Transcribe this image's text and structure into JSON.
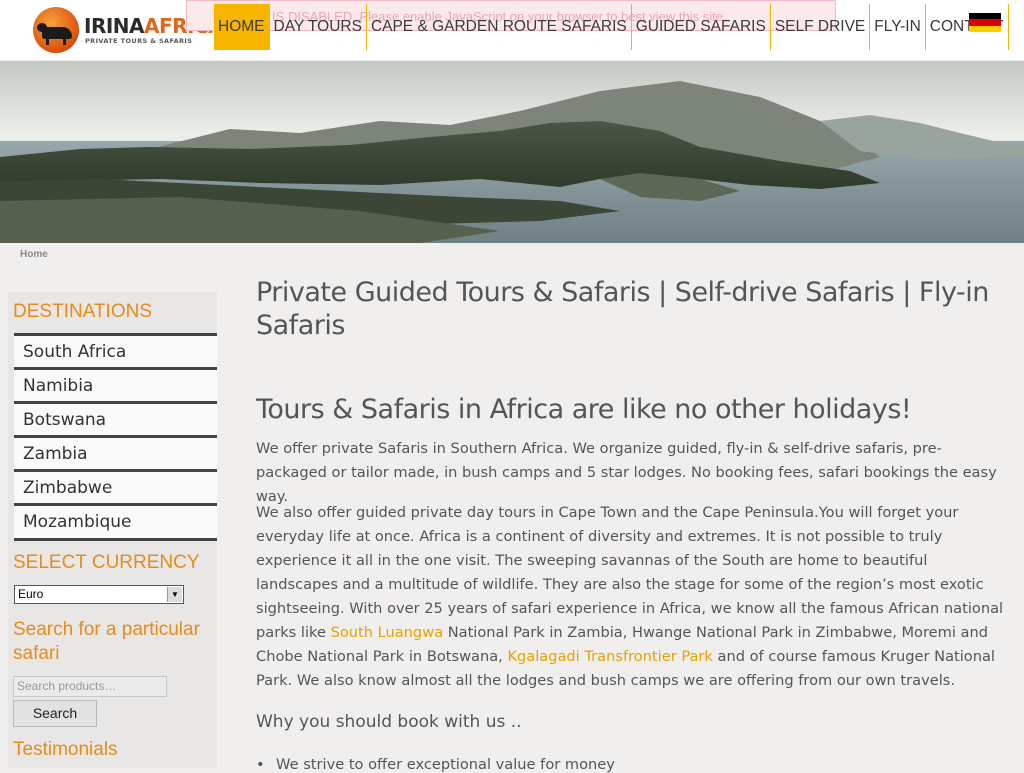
{
  "brand": {
    "name_part1": "IRINA",
    "name_part2": "AFRICA",
    "tagline": "PRIVATE TOURS & SAFARIS"
  },
  "noscript_message": "SCRIPT IS DISABLED. Please enable JavaScript on your browser to best view this site.",
  "nav": [
    {
      "label": "HOME",
      "active": true
    },
    {
      "label": "DAY TOURS"
    },
    {
      "label": "CAPE & GARDEN ROUTE SAFARIS"
    },
    {
      "label": "GUIDED SAFARIS"
    },
    {
      "label": "SELF DRIVE"
    },
    {
      "label": "FLY-IN"
    },
    {
      "label": "CONTACT"
    }
  ],
  "language_flag": {
    "colors": [
      "#000000",
      "#dd0000",
      "#ffce00"
    ]
  },
  "breadcrumb": {
    "home": "Home"
  },
  "sidebar": {
    "destinations_title": "DESTINATIONS",
    "destinations": [
      "South Africa",
      "Namibia",
      "Botswana",
      "Zambia",
      "Zimbabwe",
      "Mozambique"
    ],
    "currency_title": "SELECT CURRENCY",
    "currency_value": "Euro",
    "search_title": "Search for a particular safari",
    "search_placeholder": "Search products…",
    "search_button": "Search",
    "testimonials_title": "Testimonials"
  },
  "main": {
    "title": "Private Guided Tours & Safaris | Self-drive Safaris | Fly-in Safaris",
    "subtitle": "Tours & Safaris in Africa are like no other holidays!",
    "intro": "We offer private Safaris in Southern Africa. We organize guided, fly-in & self-drive safaris, pre-packaged or tailor made, in bush camps and 5 star lodges. No booking fees, safari bookings the easy way.",
    "body_part1": "We also offer guided private day tours in Cape Town and the Cape Peninsula.You will forget your everyday life at once. Africa is a continent of diversity and extremes. It is not possible to truly experience it all in the one visit. The sweeping savannas of the South are home to beautiful landscapes and a multitude of wildlife. They are also the stage for some of the region’s most exotic sightseeing.  With over 25 years of safari experience in Africa, we know all the famous African national parks like ",
    "link1": "South Luangwa",
    "body_part2": " National Park in Zambia, Hwange National Park in Zimbabwe, Moremi and Chobe National Park in Botswana, ",
    "link2": "Kgalagadi Transfrontier Park",
    "body_part3": " and of course famous Kruger National Park. We also know almost all the lodges and bush camps we are offering from our own travels.",
    "why_heading": "Why you should book with us ..",
    "bullet1": "We strive to offer exceptional value for money"
  },
  "colors": {
    "accent": "#f7b500",
    "heading_orange": "#e78b1a",
    "link": "#e8a100"
  }
}
